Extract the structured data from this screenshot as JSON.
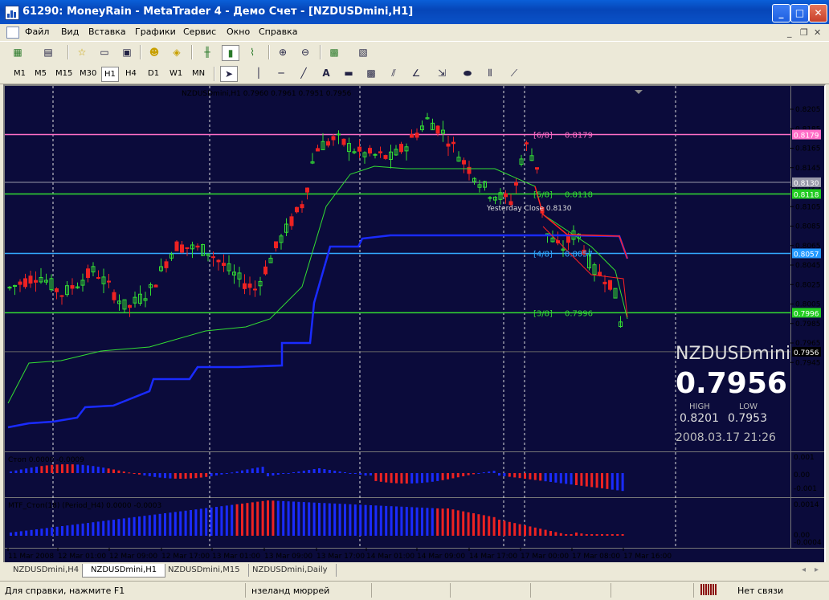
{
  "window": {
    "title": "61290: MoneyRain - MetaTrader 4 - Демо Счет - [NZDUSDmini,H1]"
  },
  "menu": [
    "Файл",
    "Вид",
    "Вставка",
    "Графики",
    "Сервис",
    "Окно",
    "Справка"
  ],
  "timeframes": [
    "M1",
    "M5",
    "M15",
    "M30",
    "H1",
    "H4",
    "D1",
    "W1",
    "MN"
  ],
  "active_timeframe": "H1",
  "chart": {
    "header_text": "NZDUSDmini,H1  0.7960 0.7961 0.7951 0.7956",
    "symbol_big": "NZDUSDmini",
    "price_big": "0.7956",
    "high_label": "HIGH",
    "low_label": "LOW",
    "high_value": "0.8201",
    "low_value": "0.7953",
    "datetime": "2008.03.17 21:26",
    "yesterday_close": "Yesterday Close 0.8130",
    "price_scale": [
      "0.8205",
      "0.8185",
      "0.8165",
      "0.8145",
      "0.8125",
      "0.8105",
      "0.8085",
      "0.8065",
      "0.8045",
      "0.8025",
      "0.8005",
      "0.7985",
      "0.7965",
      "0.7945"
    ],
    "level_labels": [
      {
        "tag": "[6/8]",
        "value": "0.8179",
        "color": "#ff6ec7"
      },
      {
        "tag": "[5/8]",
        "value": "0.8118",
        "color": "#33dd33"
      },
      {
        "tag": "[4/8]",
        "value": "0.8057",
        "color": "#33aaff"
      },
      {
        "tag": "[3/8]",
        "value": "0.7996",
        "color": "#33dd33"
      }
    ],
    "axis_badges": [
      {
        "value": "0.8179",
        "color": "#ff6ec7"
      },
      {
        "value": "0.8130",
        "color": "#9999aa"
      },
      {
        "value": "0.8118",
        "color": "#22cc22"
      },
      {
        "value": "0.8057",
        "color": "#2299ff"
      },
      {
        "value": "0.7996",
        "color": "#22cc22"
      },
      {
        "value": "0.7956",
        "color": "#000000"
      }
    ],
    "time_labels": [
      "11 Mar 2008",
      "12 Mar 01:00",
      "12 Mar 09:00",
      "12 Mar 17:00",
      "13 Mar 01:00",
      "13 Mar 09:00",
      "13 Mar 17:00",
      "14 Mar 01:00",
      "14 Mar 09:00",
      "14 Mar 17:00",
      "17 Mar 00:00",
      "17 Mar 08:00",
      "17 Mar 16:00"
    ]
  },
  "indicators": {
    "ind1_label": "Стоп 0.0000 -0.0009",
    "ind1_scale": [
      "0.001",
      "0.00",
      "-0.001"
    ],
    "ind2_label": "MTF_Стоп(18) (Period_H4) 0.0000 -0.0003",
    "ind2_scale": [
      "0.0014",
      "0.00",
      "-0.0004"
    ]
  },
  "tabs": [
    "NZDUSDmini,H4",
    "NZDUSDmini,H1",
    "NZDUSDmini,M15",
    "NZDUSDmini,Daily"
  ],
  "active_tab": "NZDUSDmini,H1",
  "status": {
    "help": "Для справки, нажмите F1",
    "profile": "нзеланд мюррей",
    "connection": "Нет связи"
  },
  "colors": {
    "chart_bg": "#0b0b3b",
    "bull": "#33dd33",
    "bear": "#ee2222",
    "accent_blue": "#1a2bff"
  }
}
